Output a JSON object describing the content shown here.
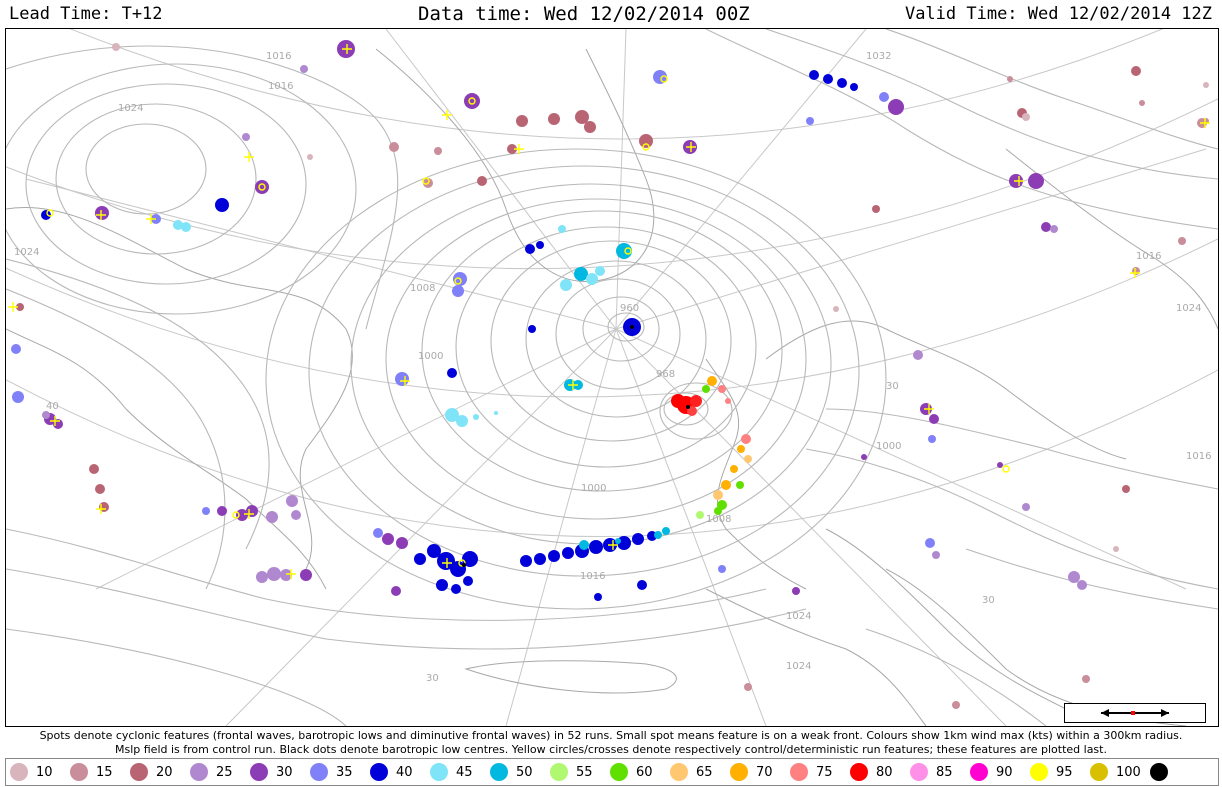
{
  "header": {
    "lead_time": "Lead Time: T+12",
    "data_time": "Data time:  Wed 12/02/2014 00Z",
    "valid_time": "Valid Time: Wed 12/02/2014 12Z"
  },
  "isobar_labels": [
    "1024",
    "1008",
    "1016",
    "1032",
    "1024",
    "1016",
    "1000",
    "1008",
    "1000",
    "1016",
    "1024",
    "1000",
    "1016",
    "1024",
    "960",
    "968",
    "30",
    "30",
    "30",
    "40",
    "1024",
    "1016"
  ],
  "notes": {
    "line1": "Spots denote cyclonic features (frontal waves, barotropic lows and diminutive frontal waves) in 52 runs. Small spot means feature is on a weak front. Colours show 1km wind max (kts) within a 300km radius.",
    "line2": "Mslp field is from control run. Black dots denote barotropic low centres. Yellow circles/crosses denote respectively control/deterministic run features; these features are plotted last."
  },
  "legend": [
    {
      "label": "10",
      "color": "#d8b4bc"
    },
    {
      "label": "15",
      "color": "#c98e9a"
    },
    {
      "label": "20",
      "color": "#b96472"
    },
    {
      "label": "25",
      "color": "#b088d0"
    },
    {
      "label": "30",
      "color": "#8c3cb4"
    },
    {
      "label": "35",
      "color": "#8080f8"
    },
    {
      "label": "40",
      "color": "#0000d8"
    },
    {
      "label": "45",
      "color": "#80e4f8"
    },
    {
      "label": "50",
      "color": "#00b8e0"
    },
    {
      "label": "55",
      "color": "#b0f870"
    },
    {
      "label": "60",
      "color": "#60e000"
    },
    {
      "label": "65",
      "color": "#ffc870"
    },
    {
      "label": "70",
      "color": "#ffb000"
    },
    {
      "label": "75",
      "color": "#ff8080"
    },
    {
      "label": "80",
      "color": "#ff0000"
    },
    {
      "label": "85",
      "color": "#ff90e8"
    },
    {
      "label": "90",
      "color": "#ff00d0"
    },
    {
      "label": "95",
      "color": "#ffff00"
    },
    {
      "label": "100",
      "color": "#d8c000"
    }
  ],
  "legend_last": {
    "label": "",
    "color": "#000000"
  }
}
